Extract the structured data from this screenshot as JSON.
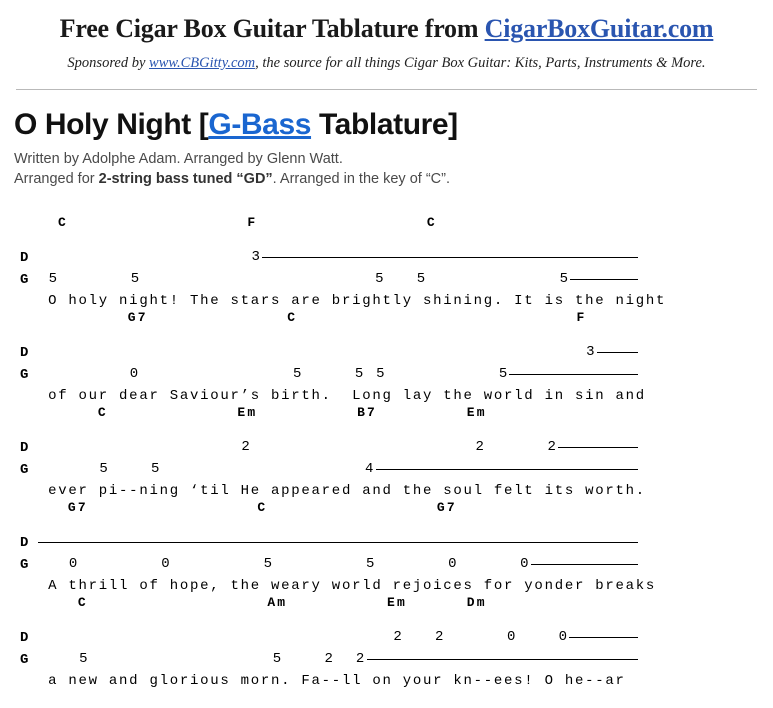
{
  "header": {
    "title_prefix": "Free Cigar Box Guitar Tablature from ",
    "title_link": "CigarBoxGuitar.com",
    "sub_prefix": "Sponsored by ",
    "sub_link": "www.CBGitty.com",
    "sub_suffix": ", the source for all things Cigar Box Guitar: Kits, Parts, Instruments & More.",
    "link_color": "#2a55b0",
    "rule_color": "#b9b9b9"
  },
  "song": {
    "title_prefix": "O Holy Night [",
    "title_link": "G-Bass",
    "title_suffix": " Tablature]",
    "title_link_color": "#1a66d0",
    "credit_1": "Written by Adolphe Adam. Arranged by Glenn Watt.",
    "credit_2_prefix": "Arranged for ",
    "credit_2_bold": "2-string bass tuned “GD”",
    "credit_2_suffix": ". Arranged in the key of “C”."
  },
  "tab": {
    "string_labels": {
      "high": "D",
      "low": "G"
    },
    "blocks": [
      {
        "chords": "  C                  F                 C",
        "frets_d": "                     3",
        "frets_g": " 5       5                       5   5             5",
        "lyrics": " O holy night! The stars are brightly shining. It is the night"
      },
      {
        "chords": "         G7              C                            F",
        "frets_d": "                                                      3",
        "frets_g": "         0               5     5 5           5",
        "lyrics": " of our dear Saviour’s birth.  Long lay the world in sin and"
      },
      {
        "chords": "      C             Em          B7         Em",
        "frets_d": "                    2                      2      2",
        "frets_g": "      5    5                    4",
        "lyrics": " ever pi--ning ‘til He appeared and the soul felt its worth."
      },
      {
        "chords": "   G7                 C                 G7",
        "frets_d": "",
        "frets_g": "   0        0         5         5       0      0",
        "lyrics": " A thrill of hope, the weary world rejoices for yonder breaks"
      },
      {
        "chords": "    C                  Am          Em      Dm",
        "frets_d": "                                   2   2      0    0",
        "frets_g": "    5                  5    2  2",
        "lyrics": " a new and glorious morn. Fa--ll on your kn--ees! O he--ar"
      }
    ]
  }
}
